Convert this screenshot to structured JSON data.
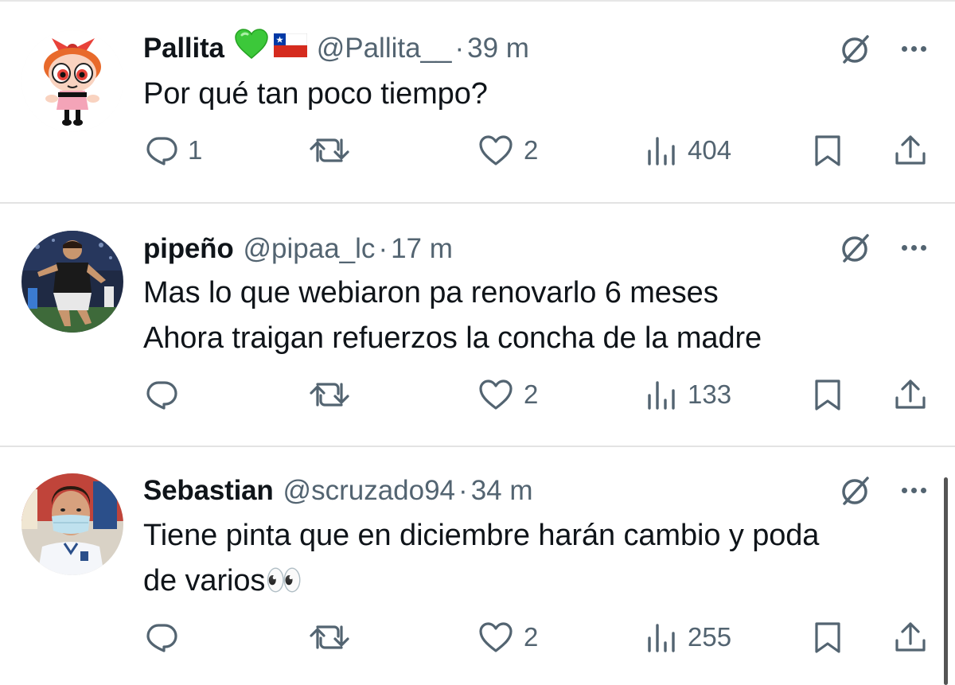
{
  "tweets": [
    {
      "display_name": "Pallita",
      "badges": [
        "green-heart",
        "chile-flag"
      ],
      "handle": "@Pallita__",
      "separator": "·",
      "time": "39 m",
      "text_lines": [
        "Por qué tan poco tiempo?"
      ],
      "avatar": "powerpuff-blossom",
      "replies": "1",
      "retweets": "",
      "likes": "2",
      "views": "404"
    },
    {
      "display_name": "pipeño",
      "badges": [],
      "handle": "@pipaa_lc",
      "separator": "·",
      "time": "17 m",
      "text_lines": [
        "Mas lo que webiaron pa renovarlo 6 meses",
        "Ahora traigan refuerzos la concha de la madre"
      ],
      "avatar": "football-player-photo",
      "replies": "",
      "retweets": "",
      "likes": "2",
      "views": "133"
    },
    {
      "display_name": "Sebastian",
      "badges": [],
      "handle": "@scruzado94",
      "separator": "·",
      "time": "34 m",
      "text_lines": [
        "Tiene pinta que en diciembre harán cambio y poda",
        "de varios👀"
      ],
      "avatar": "man-with-mask-photo",
      "replies": "",
      "retweets": "",
      "likes": "2",
      "views": "255"
    }
  ],
  "icons": {
    "reply": "reply-icon",
    "retweet": "retweet-icon",
    "like": "like-icon",
    "views": "views-icon",
    "bookmark": "bookmark-icon",
    "share": "share-icon",
    "grok": "grok-icon",
    "more": "more-icon"
  },
  "colors": {
    "text_primary": "#0f1419",
    "text_secondary": "#536471",
    "divider": "#e3e3e3",
    "background": "#ffffff",
    "green_heart": "#2ecc40",
    "chile_red": "#d52b1e",
    "chile_blue": "#0039a6"
  }
}
